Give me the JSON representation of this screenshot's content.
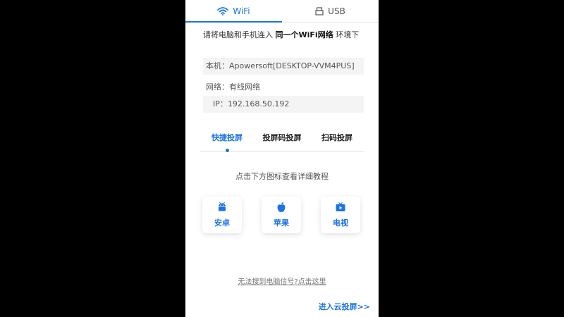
{
  "connection_tabs": [
    {
      "label": "WiFi",
      "icon": "wifi-icon",
      "active": true
    },
    {
      "label": "USB",
      "icon": "usb-icon",
      "active": false
    }
  ],
  "intro": {
    "prefix": "请将电脑和手机连入 ",
    "highlight": "同一个WiFi网络",
    "suffix": " 环境下"
  },
  "device": {
    "host_label": "本机：",
    "host_value": "Apowersoft[DESKTOP-VVM4PUS]",
    "network_label": "网络：",
    "network_value": "有线网络",
    "ip_label": "IP：",
    "ip_value": "192.168.50.192"
  },
  "mode_tabs": [
    {
      "label": "快捷投屏",
      "active": true
    },
    {
      "label": "投屏码投屏",
      "active": false
    },
    {
      "label": "扫码投屏",
      "active": false
    }
  ],
  "hint": "点击下方图标查看详细教程",
  "platforms": [
    {
      "label": "安卓",
      "icon": "android-icon"
    },
    {
      "label": "苹果",
      "icon": "apple-icon"
    },
    {
      "label": "电视",
      "icon": "tv-icon"
    }
  ],
  "help_link": "无法搜到电脑信号?点击这里",
  "cloud_link": "进入云投屏>>",
  "colors": {
    "accent": "#1a73e8",
    "background": "#000000",
    "panel": "#ffffff"
  }
}
